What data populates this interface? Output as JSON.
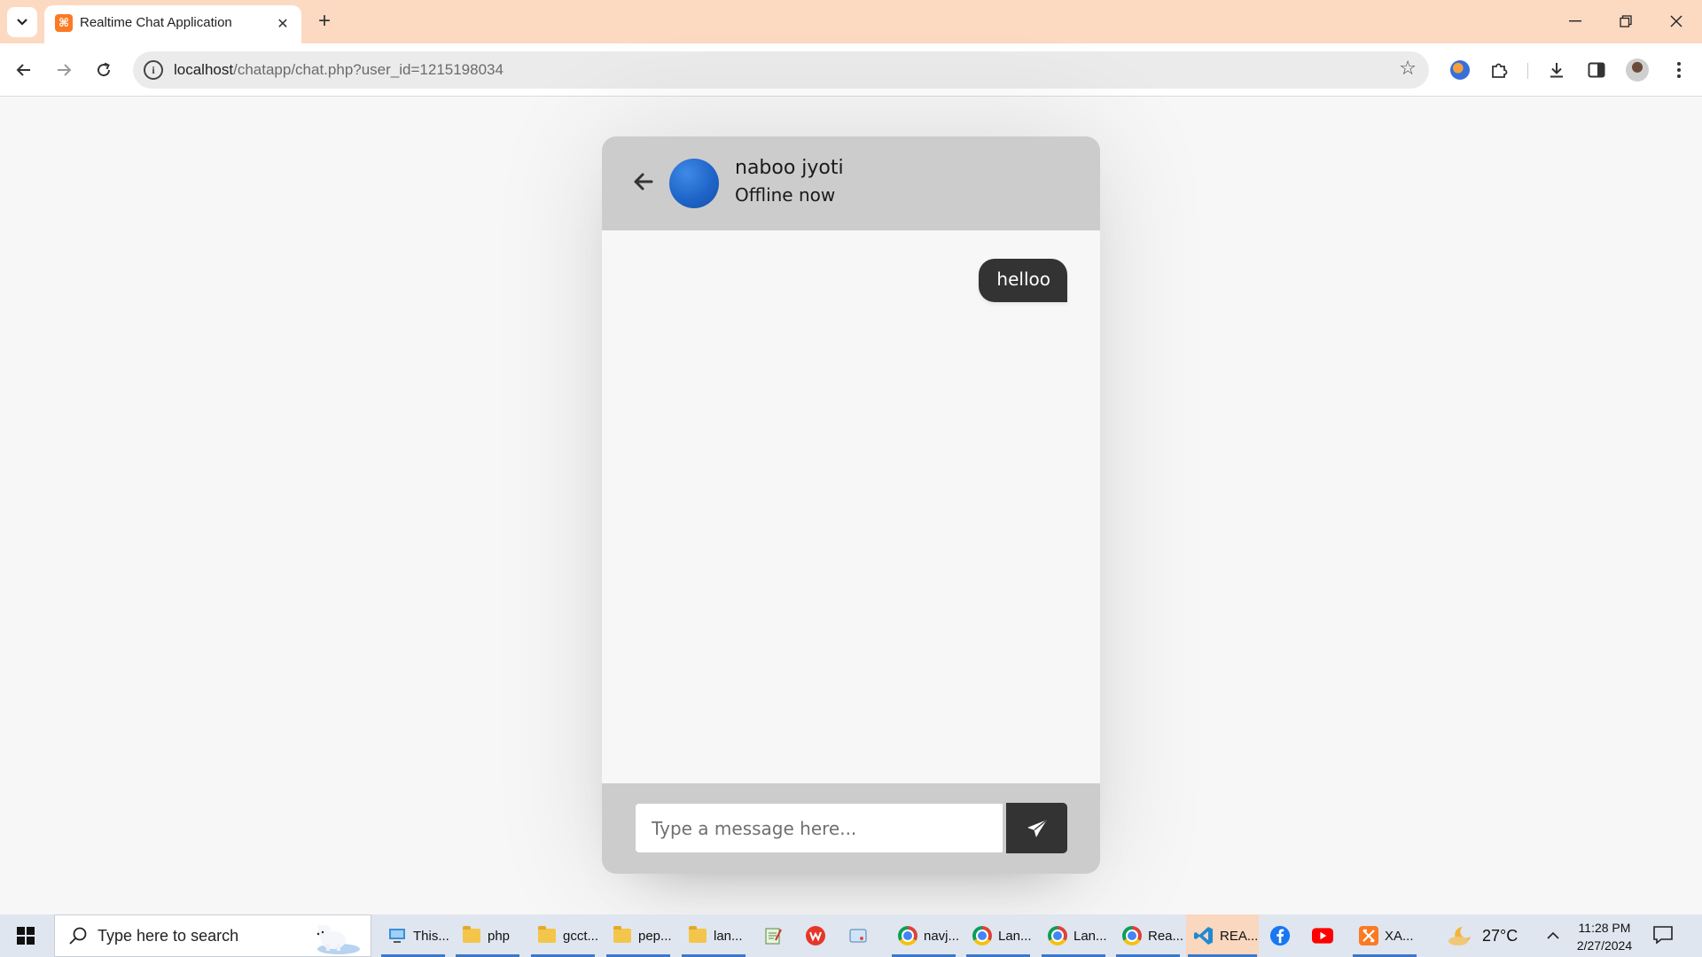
{
  "browser": {
    "tab_title": "Realtime Chat Application",
    "url_host": "localhost",
    "url_path": "/chatapp/chat.php?user_id=1215198034",
    "favicon_icon": "xampp-icon"
  },
  "chat": {
    "user_name": "naboo jyoti",
    "user_status": "Offline now",
    "messages": [
      {
        "direction": "outgoing",
        "text": "helloo"
      }
    ],
    "input_placeholder": "Type a message here...",
    "input_value": ""
  },
  "taskbar": {
    "search_placeholder": "Type here to search",
    "apps": [
      {
        "label": "This...",
        "icon": "computer-icon"
      },
      {
        "label": "php",
        "icon": "folder-icon"
      },
      {
        "label": "gcct...",
        "icon": "folder-icon"
      },
      {
        "label": "pep...",
        "icon": "folder-icon"
      },
      {
        "label": "lan...",
        "icon": "folder-icon"
      },
      {
        "label": "",
        "icon": "notepad-icon"
      },
      {
        "label": "",
        "icon": "wps-office-icon"
      },
      {
        "label": "",
        "icon": "snipping-tool-icon"
      },
      {
        "label": "navj...",
        "icon": "chrome-icon"
      },
      {
        "label": "Lan...",
        "icon": "chrome-icon"
      },
      {
        "label": "Lan...",
        "icon": "chrome-icon"
      },
      {
        "label": "Rea...",
        "icon": "chrome-icon"
      },
      {
        "label": "REA...",
        "icon": "vscode-icon"
      },
      {
        "label": "",
        "icon": "facebook-icon"
      },
      {
        "label": "",
        "icon": "youtube-icon"
      },
      {
        "label": "XA...",
        "icon": "xampp-icon"
      }
    ],
    "weather": "27°C",
    "time": "11:28 PM",
    "date": "2/27/2024"
  },
  "colors": {
    "tabbar_bg": "#fcd9c1",
    "chat_header_bg": "#cccccc",
    "bubble_bg": "#333333",
    "avatar_blue": "#1f65c9"
  }
}
